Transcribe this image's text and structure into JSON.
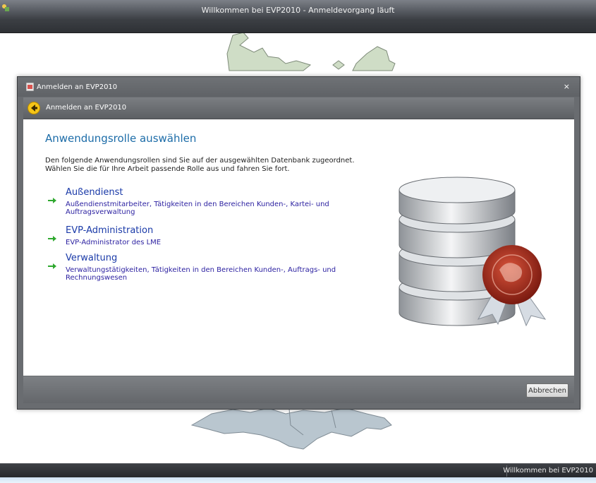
{
  "window": {
    "title": "Willkommen bei EVP2010 - Anmeldevorgang läuft",
    "status_text": "Willkommen bei EVP2010"
  },
  "dialog": {
    "title": "Anmelden an EVP2010",
    "close_label": "×",
    "nav_title": "Anmelden an EVP2010",
    "heading": "Anwendungsrolle auswählen",
    "intro": "Den folgende Anwendungsrollen sind Sie auf der ausgewählten Datenbank zugeordnet. Wählen Sie die für Ihre Arbeit passende Rolle aus und fahren Sie fort.",
    "roles": [
      {
        "title": "Außendienst",
        "description": "Außendienstmitarbeiter, Tätigkeiten in den Bereichen Kunden-, Kartei- und Auftragsverwaltung"
      },
      {
        "title": "EVP-Administration",
        "description": "EVP-Administrator des LME"
      },
      {
        "title": "Verwaltung",
        "description": "Verwaltungstätigkeiten, Tätigkeiten in den Bereichen Kunden-, Auftrags- und Rechnungswesen"
      }
    ],
    "cancel_label": "Abbrechen"
  },
  "colors": {
    "heading": "#1c6ca8",
    "role_title": "#1a3aa8",
    "role_arrow": "#2fa82f",
    "map_fill": "#c7d6c0"
  }
}
